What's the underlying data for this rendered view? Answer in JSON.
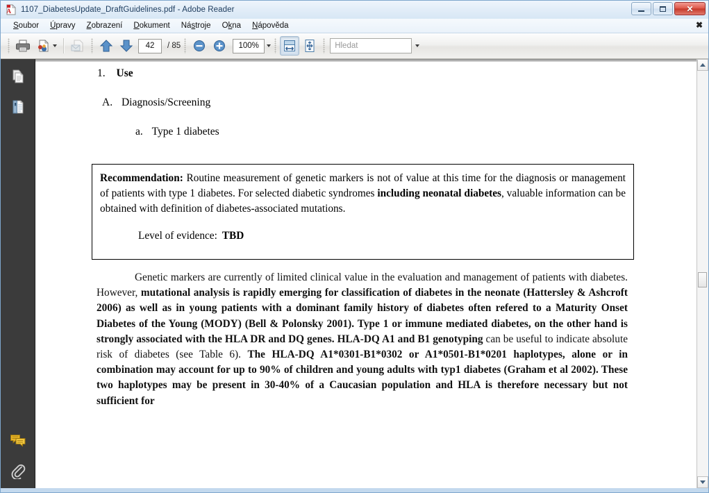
{
  "window": {
    "title": "1107_DiabetesUpdate_DraftGuidelines.pdf - Adobe Reader",
    "icon": "adobe-pdf-icon",
    "minimize_label": "Minimize",
    "maximize_label": "Maximize",
    "close_label": "Close"
  },
  "menu": {
    "items": [
      {
        "label": "Soubor",
        "accel": "S",
        "pre": "",
        "post": "oubor"
      },
      {
        "label": "Úpravy",
        "accel": "Ú",
        "pre": "",
        "post": "pravy"
      },
      {
        "label": "Zobrazení",
        "accel": "Z",
        "pre": "",
        "post": "obrazení"
      },
      {
        "label": "Dokument",
        "accel": "D",
        "pre": "",
        "post": "okument"
      },
      {
        "label": "Nástroje",
        "accel": "s",
        "pre": "Ná",
        "post": "troje"
      },
      {
        "label": "Okna",
        "accel": "k",
        "pre": "O",
        "post": "na"
      },
      {
        "label": "Nápověda",
        "accel": "N",
        "pre": "",
        "post": "ápověda"
      }
    ],
    "close_x": "✖"
  },
  "toolbar": {
    "print_icon": "printer-icon",
    "share_icon": "share-document-icon",
    "share_dropdown": "chevron-down-icon",
    "email_icon": "email-document-icon",
    "prev_page_icon": "arrow-up-icon",
    "next_page_icon": "arrow-down-icon",
    "page_number": "42",
    "page_total": "/ 85",
    "zoom_out_icon": "zoom-out-icon",
    "zoom_in_icon": "zoom-in-icon",
    "zoom_value": "100%",
    "zoom_dropdown": "chevron-down-icon",
    "fit_width_icon": "fit-width-icon",
    "fit_page_icon": "fit-page-icon",
    "search_placeholder": "Hledat",
    "search_value": "",
    "search_dropdown": "chevron-down-icon"
  },
  "nav_pane": {
    "items": [
      {
        "name": "page-thumbnails-icon",
        "label": "Stránky"
      },
      {
        "name": "bookmarks-icon",
        "label": "Záložky"
      },
      {
        "name": "comments-icon",
        "label": "Komentáře"
      },
      {
        "name": "attachments-icon",
        "label": "Přílohy"
      }
    ]
  },
  "document": {
    "headings": {
      "item_1_num": "1.",
      "item_1_text": "Use",
      "item_a_num": "A.",
      "item_a_text": "Diagnosis/Screening",
      "item_sub_num": "a.",
      "item_sub_text": "Type 1 diabetes"
    },
    "recommendation": {
      "label": "Recommendation:",
      "body_1": "  Routine measurement of genetic markers is not of value at this time for the diagnosis or management of patients with type 1 diabetes.  For selected diabetic syndromes ",
      "bold_1": "including neonatal diabetes",
      "body_2": ", valuable information can be obtained with definition of diabetes-associated mutations.",
      "evidence_label": "Level of evidence:",
      "evidence_value": "TBD"
    },
    "paragraph": {
      "normal_1": "Genetic markers are currently of limited clinical value in the evaluation and management of patients with diabetes. However, ",
      "bold_1": "mutational analysis is rapidly emerging for classification of diabetes in the neonate (Hattersley & Ashcroft 2006) as well as in young patients with a dominant family history of diabetes often refered to a Maturity Onset Diabetes of the Young (MODY) (Bell & Polonsky 2001).  Type 1 or immune mediated diabetes, on the other hand is strongly associated with the HLA DR and DQ genes.  HLA-DQ A1 and B1 genotyping",
      "normal_2": " can be useful to indicate absolute risk of diabetes (see Table 6). ",
      "bold_2": "The HLA-DQ A1*0301-B1*0302 or A1*0501-B1*0201 haplotypes, alone or in combination may account for up to 90% of children and young adults with typ1 diabetes (Graham et al 2002). These two haplotypes may be present in 30-40% of a Caucasian population and  HLA is therefore necessary but not sufficient for"
    }
  },
  "scrollbar": {
    "up_icon": "scroll-up-icon",
    "down_icon": "scroll-down-icon"
  },
  "colors": {
    "accent": "#4a77a8",
    "nav_pane_bg": "#3b3b3b",
    "close_button": "#c63a2c"
  }
}
